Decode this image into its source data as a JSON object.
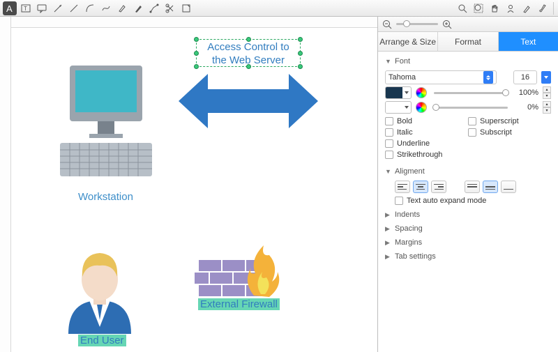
{
  "toolbar_icons": [
    "font-tool",
    "text-tool",
    "comment-tool",
    "arrow-tool",
    "line-tool",
    "arc-tool",
    "curve-tool",
    "highlight-tool",
    "pen-tool",
    "connector-tool",
    "scissors-tool",
    "note-tool"
  ],
  "toolbar_icons2": [
    "zoom-tool",
    "zoom-fit-tool",
    "hand-tool",
    "user-tool",
    "eyedropper-tool",
    "brush-tool"
  ],
  "zoom": {
    "minus": "−",
    "plus": "+"
  },
  "tabs": {
    "arrange": "Arrange & Size",
    "format": "Format",
    "text": "Text"
  },
  "font": {
    "section": "Font",
    "family": "Tahoma",
    "size": "16",
    "opacity1": "100%",
    "opacity2": "0%",
    "styles": {
      "bold": "Bold",
      "italic": "Italic",
      "underline": "Underline",
      "strike": "Strikethrough",
      "super": "Superscript",
      "sub": "Subscript"
    }
  },
  "align": {
    "section": "Aligment",
    "auto": "Text auto expand mode"
  },
  "sections": {
    "indents": "Indents",
    "spacing": "Spacing",
    "margins": "Margins",
    "tabs": "Tab settings"
  },
  "canvas": {
    "workstation": "Workstation",
    "enduser": "End User",
    "firewall": "External Firewall",
    "access_l1": "Access Control to",
    "access_l2": "the Web Server"
  }
}
